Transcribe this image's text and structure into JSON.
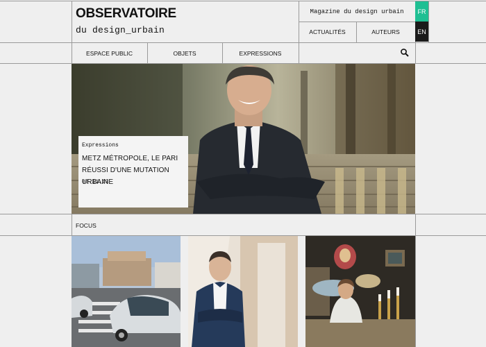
{
  "site": {
    "logo_title": "OBSERVATOIRE",
    "logo_subtitle": "du design_urbain",
    "tagline": "Magazine du design urbain",
    "lang_fr": "FR",
    "lang_en": "EN",
    "accent_color": "#1fbf93"
  },
  "top_nav": {
    "items": [
      "ACTUALITÉS",
      "AUTEURS"
    ]
  },
  "main_nav": {
    "items": [
      "ESPACE PUBLIC",
      "OBJETS",
      "EXPRESSIONS"
    ],
    "search_icon": "search-icon"
  },
  "hero": {
    "category": "Expressions",
    "title": "METZ MÉTROPOLE, LE PARI RÉUSSI D'UNE MUTATION URBAINE",
    "date": "08.11.13"
  },
  "focus": {
    "label": "FOCUS"
  }
}
